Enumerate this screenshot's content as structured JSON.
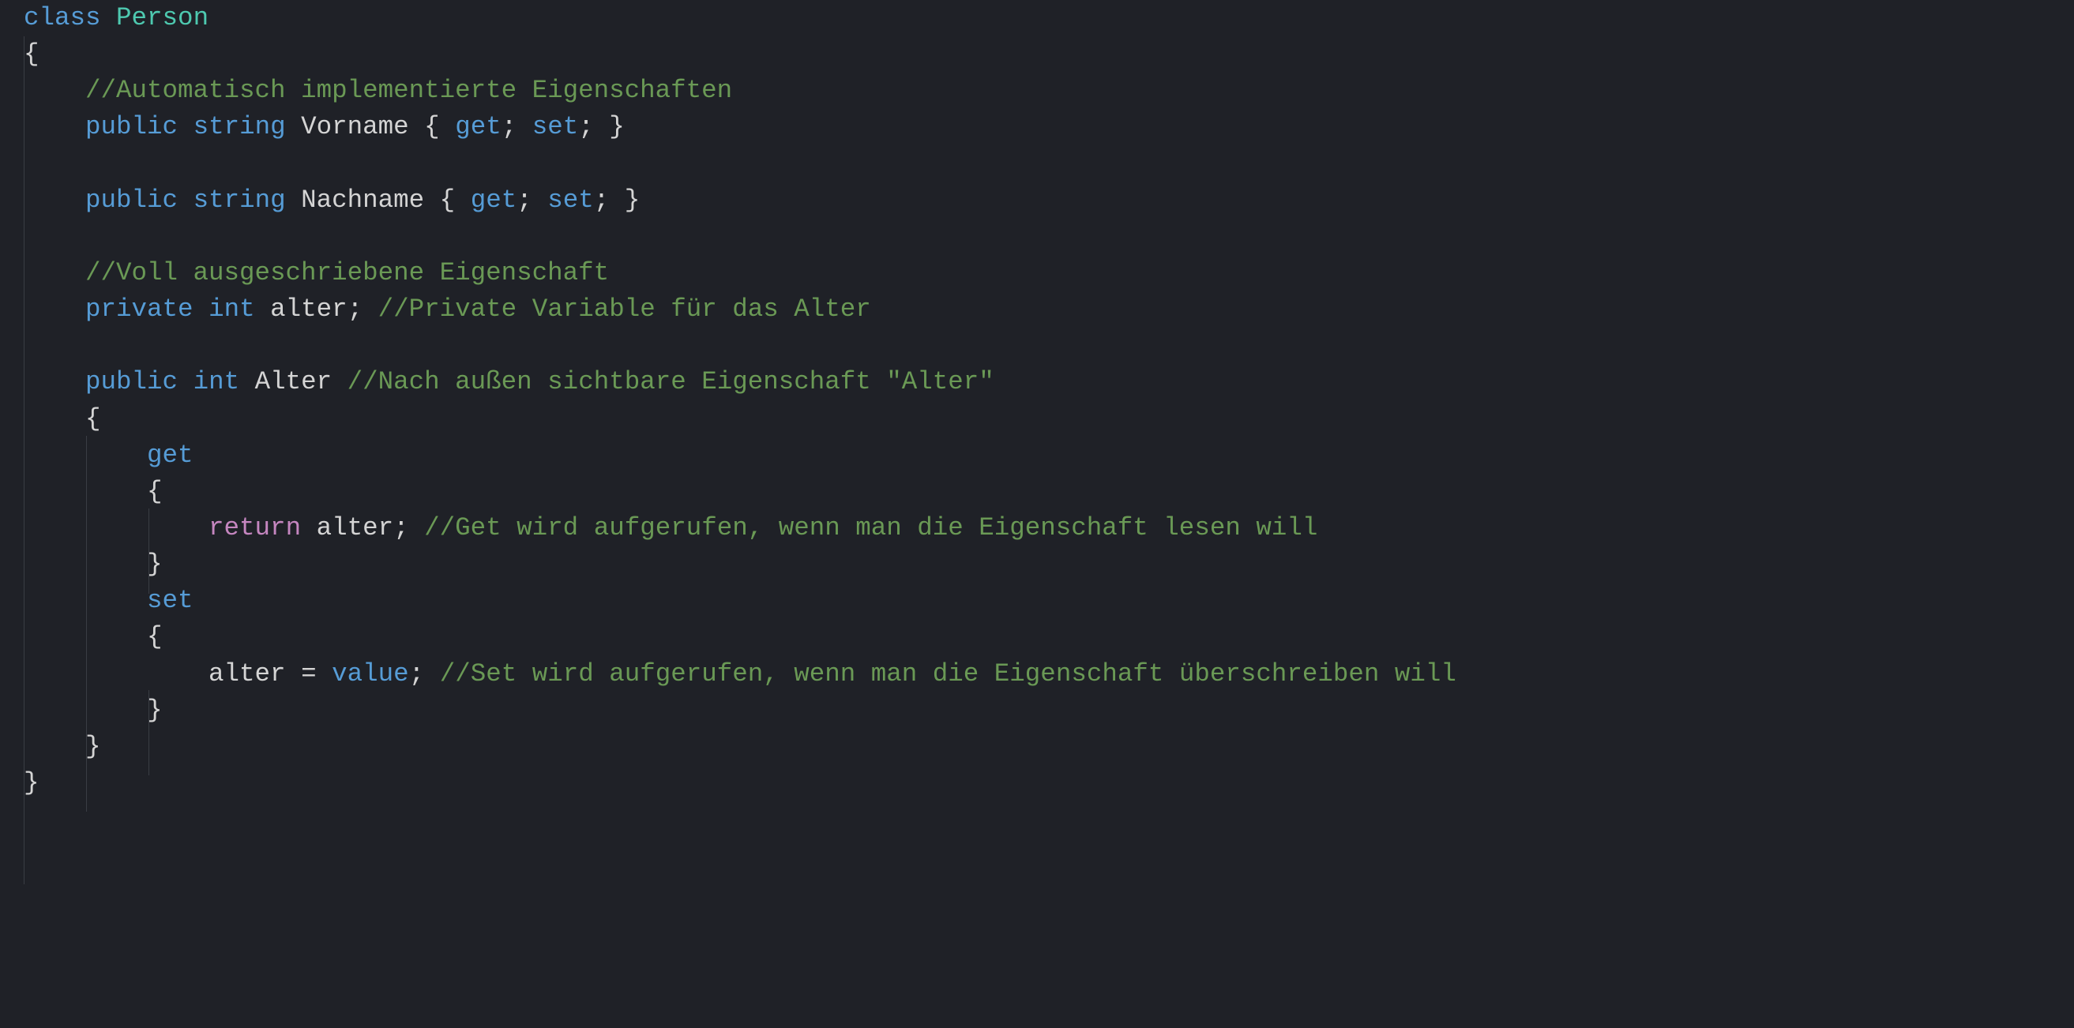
{
  "code": {
    "l1_kw_class": "class",
    "l1_type_person": "Person",
    "l2_brace_open": "{",
    "l3_comment_auto": "//Automatisch implementierte Eigenschaften",
    "l4_kw_public": "public",
    "l4_kw_string": "string",
    "l4_id_vorname": "Vorname",
    "l4_brace_open": "{",
    "l4_kw_get": "get",
    "l4_semi1": ";",
    "l4_kw_set": "set",
    "l4_semi2": ";",
    "l4_brace_close": "}",
    "l6_kw_public": "public",
    "l6_kw_string": "string",
    "l6_id_nachname": "Nachname",
    "l6_brace_open": "{",
    "l6_kw_get": "get",
    "l6_semi1": ";",
    "l6_kw_set": "set",
    "l6_semi2": ";",
    "l6_brace_close": "}",
    "l8_comment_voll": "//Voll ausgeschriebene Eigenschaft",
    "l9_kw_private": "private",
    "l9_kw_int": "int",
    "l9_id_alter": "alter",
    "l9_semi": ";",
    "l9_comment_priv": "//Private Variable für das Alter",
    "l11_kw_public": "public",
    "l11_kw_int": "int",
    "l11_id_alter": "Alter",
    "l11_comment": "//Nach außen sichtbare Eigenschaft \"Alter\"",
    "l12_brace_open": "{",
    "l13_kw_get": "get",
    "l14_brace_open": "{",
    "l15_kw_return": "return",
    "l15_id_alter": "alter",
    "l15_semi": ";",
    "l15_comment": "//Get wird aufgerufen, wenn man die Eigenschaft lesen will",
    "l16_brace_close": "}",
    "l17_kw_set": "set",
    "l18_brace_open": "{",
    "l19_id_alter": "alter",
    "l19_eq": "=",
    "l19_kw_value": "value",
    "l19_semi": ";",
    "l19_comment": "//Set wird aufgerufen, wenn man die Eigenschaft überschreiben will",
    "l20_brace_close": "}",
    "l21_brace_close": "}",
    "l22_brace_close": "}"
  }
}
